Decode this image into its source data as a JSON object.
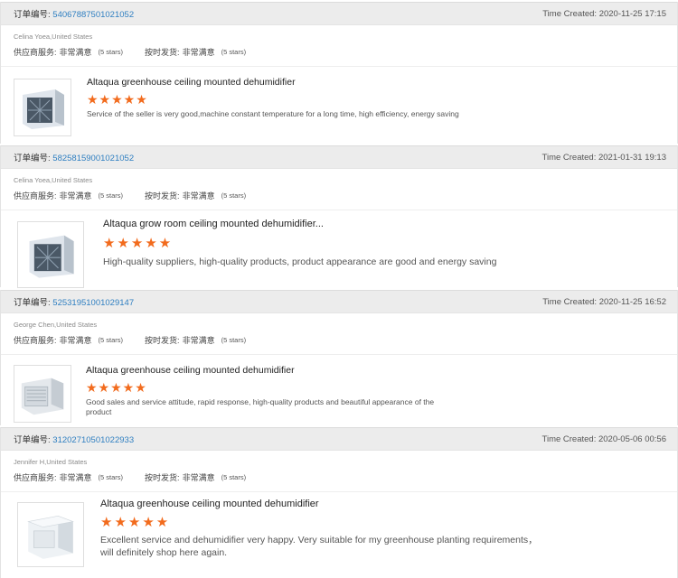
{
  "reviews": [
    {
      "order_label": "订单编号:",
      "order_number": "54067887501021052",
      "time_created": "Time Created: 2020-11-25 17:15",
      "buyer": "Celina Yoea,United States",
      "supplier_label": "供应商服务:",
      "supplier_value": "非常满意",
      "supplier_stars": "(5 stars)",
      "ship_label": "按时发货:",
      "ship_value": "非常满意",
      "ship_stars": "(5 stars)",
      "product_title": "Altaqua greenhouse ceiling mounted dehumidifier",
      "stars": "★★★★★",
      "comment": "Service of the seller is very good,machine constant temperature for a long time, high efficiency, energy saving"
    },
    {
      "order_label": "订单编号:",
      "order_number": "58258159001021052",
      "time_created": "Time Created: 2021-01-31 19:13",
      "buyer": "Celina Yoea,United States",
      "supplier_label": "供应商服务:",
      "supplier_value": "非常满意",
      "supplier_stars": "(5 stars)",
      "ship_label": "按时发货:",
      "ship_value": "非常满意",
      "ship_stars": "(5 stars)",
      "product_title": "Altaqua grow room ceiling mounted dehumidifier...",
      "stars": "★★★★★",
      "comment": "High-quality suppliers, high-quality products, product appearance are good and energy saving"
    },
    {
      "order_label": "订单编号:",
      "order_number": "52531951001029147",
      "time_created": "Time Created: 2020-11-25 16:52",
      "buyer": "George Chen,United States",
      "supplier_label": "供应商服务:",
      "supplier_value": "非常满意",
      "supplier_stars": "(5 stars)",
      "ship_label": "按时发货:",
      "ship_value": "非常满意",
      "ship_stars": "(5 stars)",
      "product_title": "Altaqua greenhouse ceiling mounted dehumidifier",
      "stars": "★★★★★",
      "comment": "Good sales and service attitude, rapid response, high-quality products and beautiful appearance of the product"
    },
    {
      "order_label": "订单编号:",
      "order_number": "31202710501022933",
      "time_created": "Time Created: 2020-05-06 00:56",
      "buyer": "Jennifer H,United States",
      "supplier_label": "供应商服务:",
      "supplier_value": "非常满意",
      "supplier_stars": "(5 stars)",
      "ship_label": "按时发货:",
      "ship_value": "非常满意",
      "ship_stars": "(5 stars)",
      "product_title": "Altaqua greenhouse ceiling mounted dehumidifier",
      "stars": "★★★★★",
      "comment": "Excellent service and dehumidifier very happy. Very suitable for my greenhouse planting requirements， will definitely shop here again."
    }
  ],
  "colors": {
    "star": "#f26b1d",
    "order_link": "#2f7fc1",
    "header_bg": "#ececec"
  },
  "icons": {
    "product_thumb": "dehumidifier-image"
  }
}
